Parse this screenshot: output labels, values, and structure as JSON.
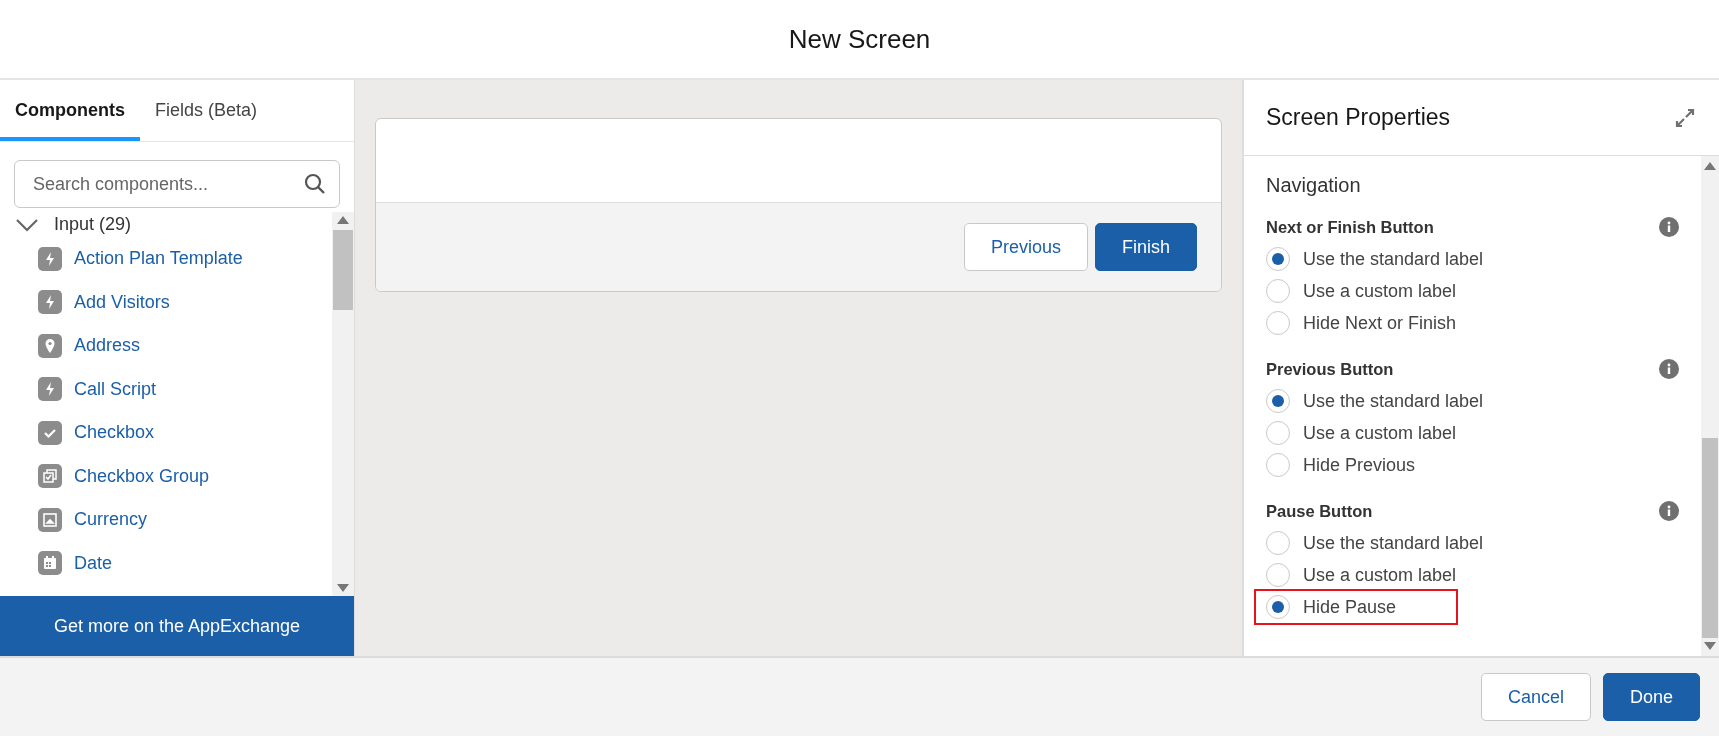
{
  "header": {
    "title": "New Screen"
  },
  "palette": {
    "tabs": [
      {
        "label": "Components",
        "selected": true
      },
      {
        "label": "Fields (Beta)",
        "selected": false
      }
    ],
    "search": {
      "placeholder": "Search components..."
    },
    "group": {
      "label": "Input (29)",
      "expanded": true,
      "items": [
        {
          "label": "Action Plan Template",
          "kind": "bolt"
        },
        {
          "label": "Add Visitors",
          "kind": "bolt"
        },
        {
          "label": "Address",
          "kind": "pin"
        },
        {
          "label": "Call Script",
          "kind": "bolt"
        },
        {
          "label": "Checkbox",
          "kind": "check"
        },
        {
          "label": "Checkbox Group",
          "kind": "checkgroup"
        },
        {
          "label": "Currency",
          "kind": "currency"
        },
        {
          "label": "Date",
          "kind": "calendar"
        }
      ]
    },
    "appexchange": "Get more on the AppExchange"
  },
  "canvas": {
    "buttons": [
      {
        "label": "Previous",
        "kind": "neutral"
      },
      {
        "label": "Finish",
        "kind": "brand"
      }
    ]
  },
  "properties": {
    "title": "Screen Properties",
    "section": "Navigation",
    "groups": [
      {
        "label": "Next or Finish Button",
        "options": [
          {
            "label": "Use the standard label",
            "selected": true,
            "highlighted": false
          },
          {
            "label": "Use a custom label",
            "selected": false,
            "highlighted": false
          },
          {
            "label": "Hide Next or Finish",
            "selected": false,
            "highlighted": false
          }
        ]
      },
      {
        "label": "Previous Button",
        "options": [
          {
            "label": "Use the standard label",
            "selected": true,
            "highlighted": false
          },
          {
            "label": "Use a custom label",
            "selected": false,
            "highlighted": false
          },
          {
            "label": "Hide Previous",
            "selected": false,
            "highlighted": false
          }
        ]
      },
      {
        "label": "Pause Button",
        "options": [
          {
            "label": "Use the standard label",
            "selected": false,
            "highlighted": false
          },
          {
            "label": "Use a custom label",
            "selected": false,
            "highlighted": false
          },
          {
            "label": "Hide Pause",
            "selected": true,
            "highlighted": true
          }
        ]
      }
    ]
  },
  "footer": {
    "buttons": [
      {
        "label": "Cancel",
        "kind": "neutral"
      },
      {
        "label": "Done",
        "kind": "brand"
      }
    ]
  }
}
